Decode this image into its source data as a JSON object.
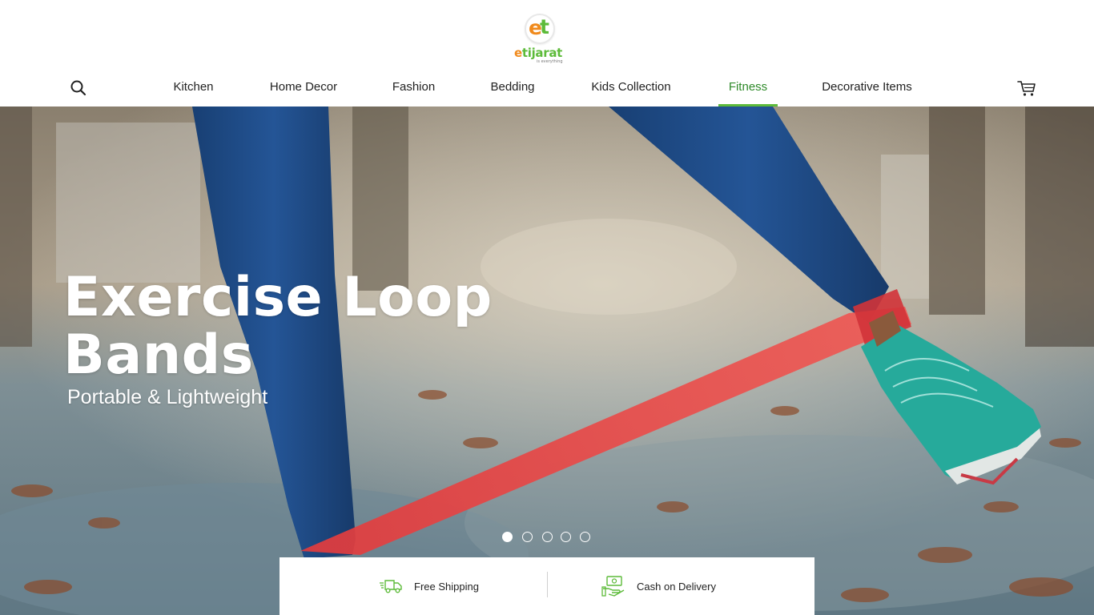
{
  "brand": {
    "logo_e": "e",
    "logo_t": "t",
    "word_prefix": "e",
    "word_rest": "tijarat",
    "tagline": "is everything"
  },
  "nav": {
    "items": [
      {
        "label": "Kitchen"
      },
      {
        "label": "Home Decor"
      },
      {
        "label": "Fashion"
      },
      {
        "label": "Bedding"
      },
      {
        "label": "Kids Collection"
      },
      {
        "label": "Fitness"
      },
      {
        "label": "Decorative Items"
      }
    ],
    "active": "Fitness"
  },
  "icons": {
    "search": "search-icon",
    "cart": "cart-icon",
    "shipping": "truck-icon",
    "cash": "cash-icon"
  },
  "hero": {
    "title_line1": "Exercise Loop",
    "title_line2": "Bands",
    "subtitle": "Portable & Lightweight",
    "slides": 5,
    "active_slide": 1
  },
  "features": {
    "shipping_label": "Free Shipping",
    "cod_label": "Cash on Delivery"
  },
  "colors": {
    "brand_green": "#5dbb3a",
    "brand_orange": "#f08a1c",
    "band_red": "#e84a4a",
    "shoe_teal": "#2bb3a3",
    "leggings_blue": "#1f4f8a"
  }
}
